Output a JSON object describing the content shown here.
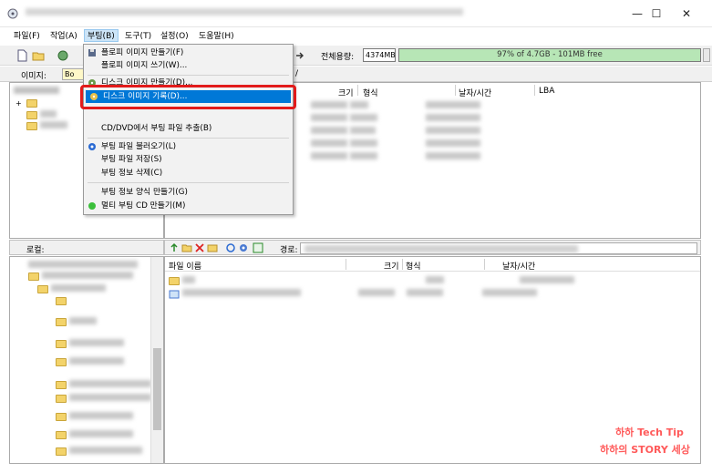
{
  "window": {
    "minimize": "—",
    "maximize": "☐",
    "close": "✕"
  },
  "menubar": {
    "items": [
      "파일(F)",
      "작업(A)",
      "부팅(B)",
      "도구(T)",
      "설정(O)",
      "도움말(H)"
    ]
  },
  "toolbar": {
    "total_label": "전체용량:",
    "total_size": "4374MB",
    "capacity_text": "97% of 4.7GB - 101MB free",
    "capacity_percent": 97,
    "capacity_color": "#b7e6b6"
  },
  "image_row": {
    "label": "이미지:",
    "value": "Bo",
    "path": "/"
  },
  "upper_table": {
    "columns": [
      "크기",
      "형식",
      "날자/시간",
      "LBA"
    ]
  },
  "lower_left": {
    "header": "로컬:"
  },
  "lower_toolbar": {
    "path_label": "경로:"
  },
  "lower_table": {
    "columns": [
      "파일 이름",
      "크기",
      "형식",
      "날자/시간"
    ]
  },
  "dropdown": {
    "items": [
      {
        "label": "플로피 이미지 만들기(F)",
        "icon": "floppy-icon"
      },
      {
        "label": "플로피 이미지 쓰기(W)...",
        "icon": ""
      },
      {
        "label": "디스크 이미지 만들기(D)...",
        "icon": "disk-image-icon"
      },
      {
        "label": "디스크 이미지 기록(D)...",
        "icon": "burn-disk-icon",
        "selected": true
      },
      {
        "label": "CD/DVD에서 부팅 파일 추출(B)",
        "icon": ""
      },
      {
        "label": "부팅 파일 불러오기(L)",
        "icon": "gear-icon"
      },
      {
        "label": "부팅 파일 저장(S)",
        "icon": ""
      },
      {
        "label": "부팅 정보 삭제(C)",
        "icon": ""
      },
      {
        "label": "부팅 정보 양식 만들기(G)",
        "icon": ""
      },
      {
        "label": "멀티 부팅 CD 만들기(M)",
        "icon": "green-orb-icon"
      }
    ],
    "highlight_color": "#e21b1b"
  },
  "watermark": {
    "line1": "하하 Tech Tip",
    "line2": "하하의 STORY 세상"
  }
}
